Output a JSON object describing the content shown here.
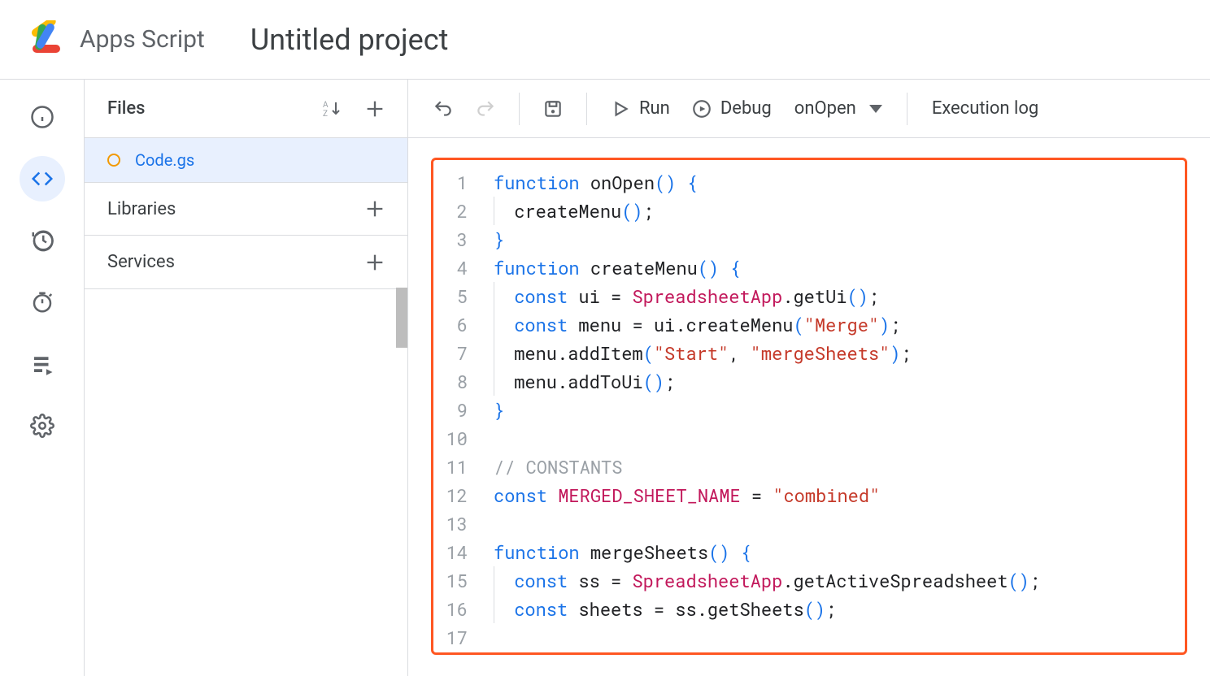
{
  "header": {
    "brand": "Apps Script",
    "project_title": "Untitled project"
  },
  "left_rail": {
    "items": [
      {
        "name": "overview-icon"
      },
      {
        "name": "editor-icon"
      },
      {
        "name": "history-icon"
      },
      {
        "name": "triggers-icon"
      },
      {
        "name": "executions-icon"
      },
      {
        "name": "settings-icon"
      }
    ]
  },
  "sidebar": {
    "files_title": "Files",
    "file_name": "Code.gs",
    "libraries_title": "Libraries",
    "services_title": "Services"
  },
  "toolbar": {
    "run_label": "Run",
    "debug_label": "Debug",
    "function_selected": "onOpen",
    "execution_log_label": "Execution log"
  },
  "editor": {
    "line_count": 17,
    "code_lines": [
      {
        "n": 1,
        "tokens": [
          {
            "t": "kw",
            "v": "function"
          },
          {
            "t": "sp",
            "v": " "
          },
          {
            "t": "fn",
            "v": "onOpen"
          },
          {
            "t": "punct",
            "v": "()"
          },
          {
            "t": "sp",
            "v": " "
          },
          {
            "t": "punct",
            "v": "{"
          }
        ]
      },
      {
        "n": 2,
        "indent": 1,
        "tokens": [
          {
            "t": "fn",
            "v": "createMenu"
          },
          {
            "t": "punct",
            "v": "()"
          },
          {
            "t": "fn",
            "v": ";"
          }
        ]
      },
      {
        "n": 3,
        "tokens": [
          {
            "t": "punct",
            "v": "}"
          }
        ]
      },
      {
        "n": 4,
        "tokens": [
          {
            "t": "kw",
            "v": "function"
          },
          {
            "t": "sp",
            "v": " "
          },
          {
            "t": "fn",
            "v": "createMenu"
          },
          {
            "t": "punct",
            "v": "()"
          },
          {
            "t": "sp",
            "v": " "
          },
          {
            "t": "punct",
            "v": "{"
          }
        ]
      },
      {
        "n": 5,
        "indent": 1,
        "tokens": [
          {
            "t": "kw",
            "v": "const"
          },
          {
            "t": "sp",
            "v": " "
          },
          {
            "t": "fn",
            "v": "ui"
          },
          {
            "t": "sp",
            "v": " "
          },
          {
            "t": "fn",
            "v": "="
          },
          {
            "t": "sp",
            "v": " "
          },
          {
            "t": "cls",
            "v": "SpreadsheetApp"
          },
          {
            "t": "fn",
            "v": ".getUi"
          },
          {
            "t": "punct",
            "v": "()"
          },
          {
            "t": "fn",
            "v": ";"
          }
        ]
      },
      {
        "n": 6,
        "indent": 1,
        "tokens": [
          {
            "t": "kw",
            "v": "const"
          },
          {
            "t": "sp",
            "v": " "
          },
          {
            "t": "fn",
            "v": "menu"
          },
          {
            "t": "sp",
            "v": " "
          },
          {
            "t": "fn",
            "v": "="
          },
          {
            "t": "sp",
            "v": " "
          },
          {
            "t": "fn",
            "v": "ui.createMenu"
          },
          {
            "t": "punct",
            "v": "("
          },
          {
            "t": "str",
            "v": "\"Merge\""
          },
          {
            "t": "punct",
            "v": ")"
          },
          {
            "t": "fn",
            "v": ";"
          }
        ]
      },
      {
        "n": 7,
        "indent": 1,
        "tokens": [
          {
            "t": "fn",
            "v": "menu.addItem"
          },
          {
            "t": "punct",
            "v": "("
          },
          {
            "t": "str",
            "v": "\"Start\""
          },
          {
            "t": "fn",
            "v": ", "
          },
          {
            "t": "str",
            "v": "\"mergeSheets\""
          },
          {
            "t": "punct",
            "v": ")"
          },
          {
            "t": "fn",
            "v": ";"
          }
        ]
      },
      {
        "n": 8,
        "indent": 1,
        "tokens": [
          {
            "t": "fn",
            "v": "menu.addToUi"
          },
          {
            "t": "punct",
            "v": "()"
          },
          {
            "t": "fn",
            "v": ";"
          }
        ]
      },
      {
        "n": 9,
        "tokens": [
          {
            "t": "punct",
            "v": "}"
          }
        ]
      },
      {
        "n": 10,
        "tokens": []
      },
      {
        "n": 11,
        "tokens": [
          {
            "t": "cmt",
            "v": "// CONSTANTS"
          }
        ]
      },
      {
        "n": 12,
        "tokens": [
          {
            "t": "kw",
            "v": "const"
          },
          {
            "t": "sp",
            "v": " "
          },
          {
            "t": "constname",
            "v": "MERGED_SHEET_NAME"
          },
          {
            "t": "sp",
            "v": " "
          },
          {
            "t": "fn",
            "v": "="
          },
          {
            "t": "sp",
            "v": " "
          },
          {
            "t": "str",
            "v": "\"combined\""
          }
        ]
      },
      {
        "n": 13,
        "tokens": []
      },
      {
        "n": 14,
        "tokens": [
          {
            "t": "kw",
            "v": "function"
          },
          {
            "t": "sp",
            "v": " "
          },
          {
            "t": "fn",
            "v": "mergeSheets"
          },
          {
            "t": "punct",
            "v": "()"
          },
          {
            "t": "sp",
            "v": " "
          },
          {
            "t": "punct",
            "v": "{"
          }
        ]
      },
      {
        "n": 15,
        "indent": 1,
        "tokens": [
          {
            "t": "kw",
            "v": "const"
          },
          {
            "t": "sp",
            "v": " "
          },
          {
            "t": "fn",
            "v": "ss"
          },
          {
            "t": "sp",
            "v": " "
          },
          {
            "t": "fn",
            "v": "="
          },
          {
            "t": "sp",
            "v": " "
          },
          {
            "t": "cls",
            "v": "SpreadsheetApp"
          },
          {
            "t": "fn",
            "v": ".getActiveSpreadsheet"
          },
          {
            "t": "punct",
            "v": "()"
          },
          {
            "t": "fn",
            "v": ";"
          }
        ]
      },
      {
        "n": 16,
        "indent": 1,
        "tokens": [
          {
            "t": "kw",
            "v": "const"
          },
          {
            "t": "sp",
            "v": " "
          },
          {
            "t": "fn",
            "v": "sheets"
          },
          {
            "t": "sp",
            "v": " "
          },
          {
            "t": "fn",
            "v": "="
          },
          {
            "t": "sp",
            "v": " "
          },
          {
            "t": "fn",
            "v": "ss.getSheets"
          },
          {
            "t": "punct",
            "v": "()"
          },
          {
            "t": "fn",
            "v": ";"
          }
        ]
      },
      {
        "n": 17,
        "tokens": []
      }
    ]
  }
}
